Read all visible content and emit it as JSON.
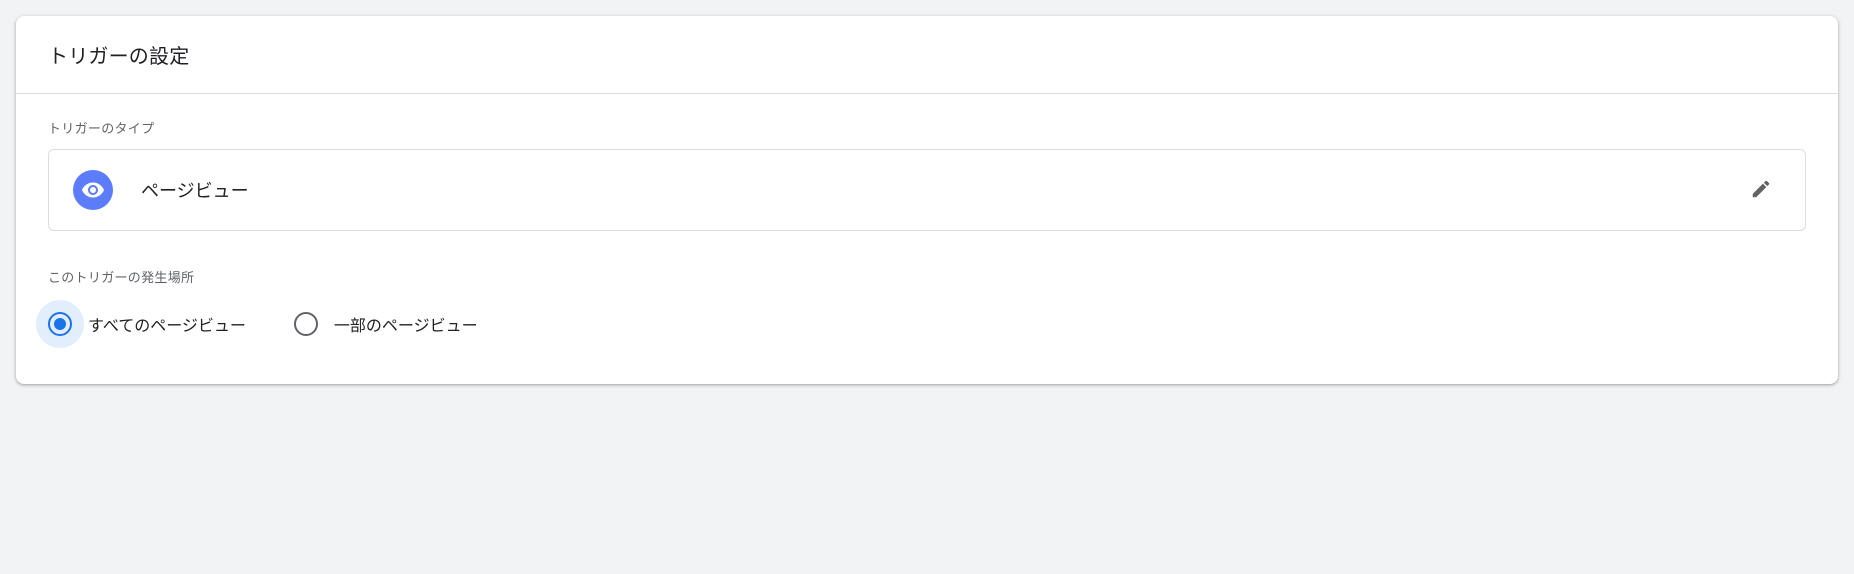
{
  "header": {
    "title": "トリガーの設定"
  },
  "trigger_type": {
    "label": "トリガーのタイプ",
    "value": "ページビュー"
  },
  "firing": {
    "label": "このトリガーの発生場所",
    "options": [
      {
        "label": "すべてのページビュー",
        "selected": true
      },
      {
        "label": "一部のページビュー",
        "selected": false
      }
    ]
  }
}
